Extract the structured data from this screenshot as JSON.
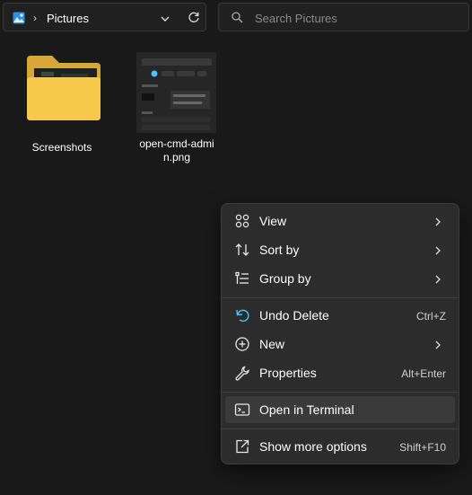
{
  "address_bar": {
    "separator": "›",
    "location": "Pictures"
  },
  "search": {
    "placeholder": "Search Pictures"
  },
  "files": [
    {
      "name": "Screenshots",
      "icon": "folder-icon"
    },
    {
      "name_line1": "open-cmd-admi",
      "name_line2": "n.png",
      "icon": "image-thumbnail"
    }
  ],
  "context_menu": {
    "items": [
      {
        "label": "View",
        "icon": "view-grid-icon",
        "submenu": true
      },
      {
        "label": "Sort by",
        "icon": "sort-icon",
        "submenu": true
      },
      {
        "label": "Group by",
        "icon": "group-by-icon",
        "submenu": true
      },
      {
        "label": "Undo Delete",
        "icon": "undo-icon",
        "shortcut": "Ctrl+Z"
      },
      {
        "label": "New",
        "icon": "new-plus-icon",
        "submenu": true
      },
      {
        "label": "Properties",
        "icon": "wrench-icon",
        "shortcut": "Alt+Enter"
      },
      {
        "label": "Open in Terminal",
        "icon": "terminal-icon",
        "highlighted": true
      },
      {
        "label": "Show more options",
        "icon": "share-icon",
        "shortcut": "Shift+F10"
      }
    ]
  },
  "colors": {
    "background": "#191919",
    "menu_bg": "#2c2c2c",
    "accent": "#4cc2ff",
    "folder_yellow": "#f6c94b"
  }
}
